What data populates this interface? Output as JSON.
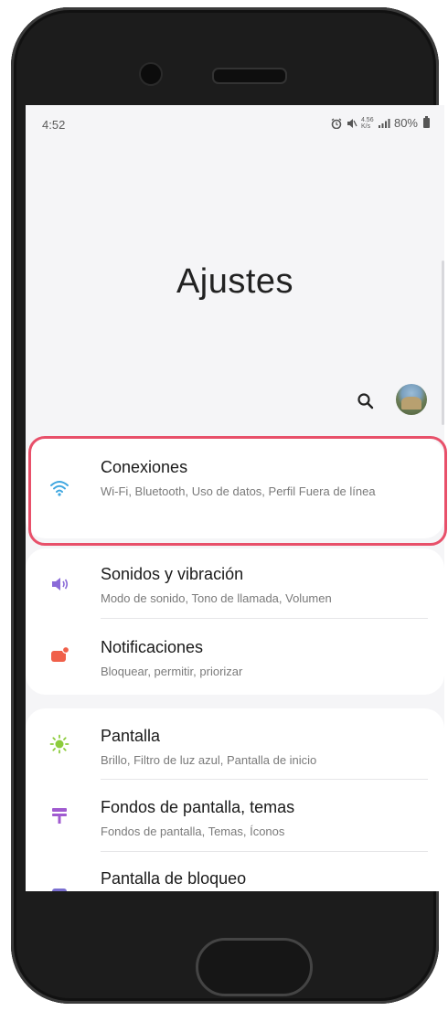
{
  "status_bar": {
    "time": "4:52",
    "network_speed": "4.56 K/s",
    "battery_percent": "80%"
  },
  "header": {
    "title": "Ajustes"
  },
  "icons": {
    "search": "search-icon",
    "avatar": "profile-avatar"
  },
  "settings": [
    {
      "title": "Conexiones",
      "subtitle": "Wi-Fi, Bluetooth, Uso de datos, Perfil Fuera de línea",
      "icon": "wifi-icon",
      "icon_color": "#3fa7e0"
    },
    {
      "title": "Sonidos y vibración",
      "subtitle": "Modo de sonido, Tono de llamada, Volumen",
      "icon": "speaker-icon",
      "icon_color": "#8a6ad8"
    },
    {
      "title": "Notificaciones",
      "subtitle": "Bloquear, permitir, priorizar",
      "icon": "notification-icon",
      "icon_color": "#f0604a"
    },
    {
      "title": "Pantalla",
      "subtitle": "Brillo, Filtro de luz azul, Pantalla de inicio",
      "icon": "sun-icon",
      "icon_color": "#8ccc3c"
    },
    {
      "title": "Fondos de pantalla, temas",
      "subtitle": "Fondos de pantalla, Temas, Íconos",
      "icon": "paint-roller-icon",
      "icon_color": "#a05bd0"
    },
    {
      "title": "Pantalla de bloqueo",
      "subtitle": "",
      "icon": "lock-screen-icon",
      "icon_color": "#7a6fd0"
    }
  ],
  "highlight_color": "#e8506a"
}
